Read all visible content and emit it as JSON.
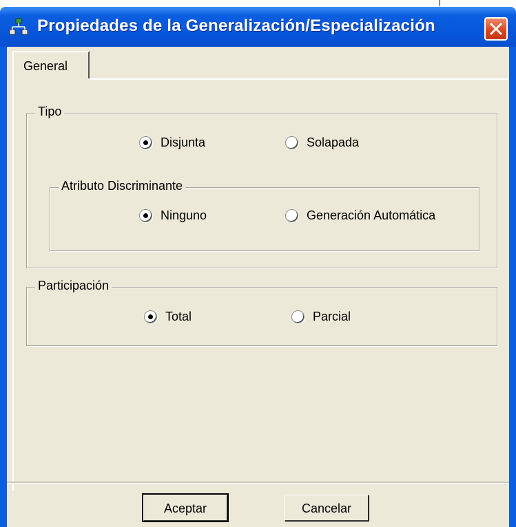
{
  "window": {
    "title": "Propiedades de la Generalización/Especialización",
    "title_icon": "hierarchy-icon",
    "close_icon": "close-icon",
    "titlebar_color": "#0a5ee0",
    "close_color": "#d9451c"
  },
  "tabs": [
    {
      "label": "General",
      "selected": true
    }
  ],
  "tipo": {
    "legend": "Tipo",
    "options": [
      {
        "label": "Disjunta",
        "checked": true
      },
      {
        "label": "Solapada",
        "checked": false
      }
    ]
  },
  "atributo": {
    "legend": "Atributo Discriminante",
    "options": [
      {
        "label": "Ninguno",
        "checked": true
      },
      {
        "label": "Generación Automática",
        "checked": false
      }
    ]
  },
  "participacion": {
    "legend": "Participación",
    "options": [
      {
        "label": "Total",
        "checked": true
      },
      {
        "label": "Parcial",
        "checked": false
      }
    ]
  },
  "buttons": {
    "accept": "Aceptar",
    "cancel": "Cancelar"
  }
}
